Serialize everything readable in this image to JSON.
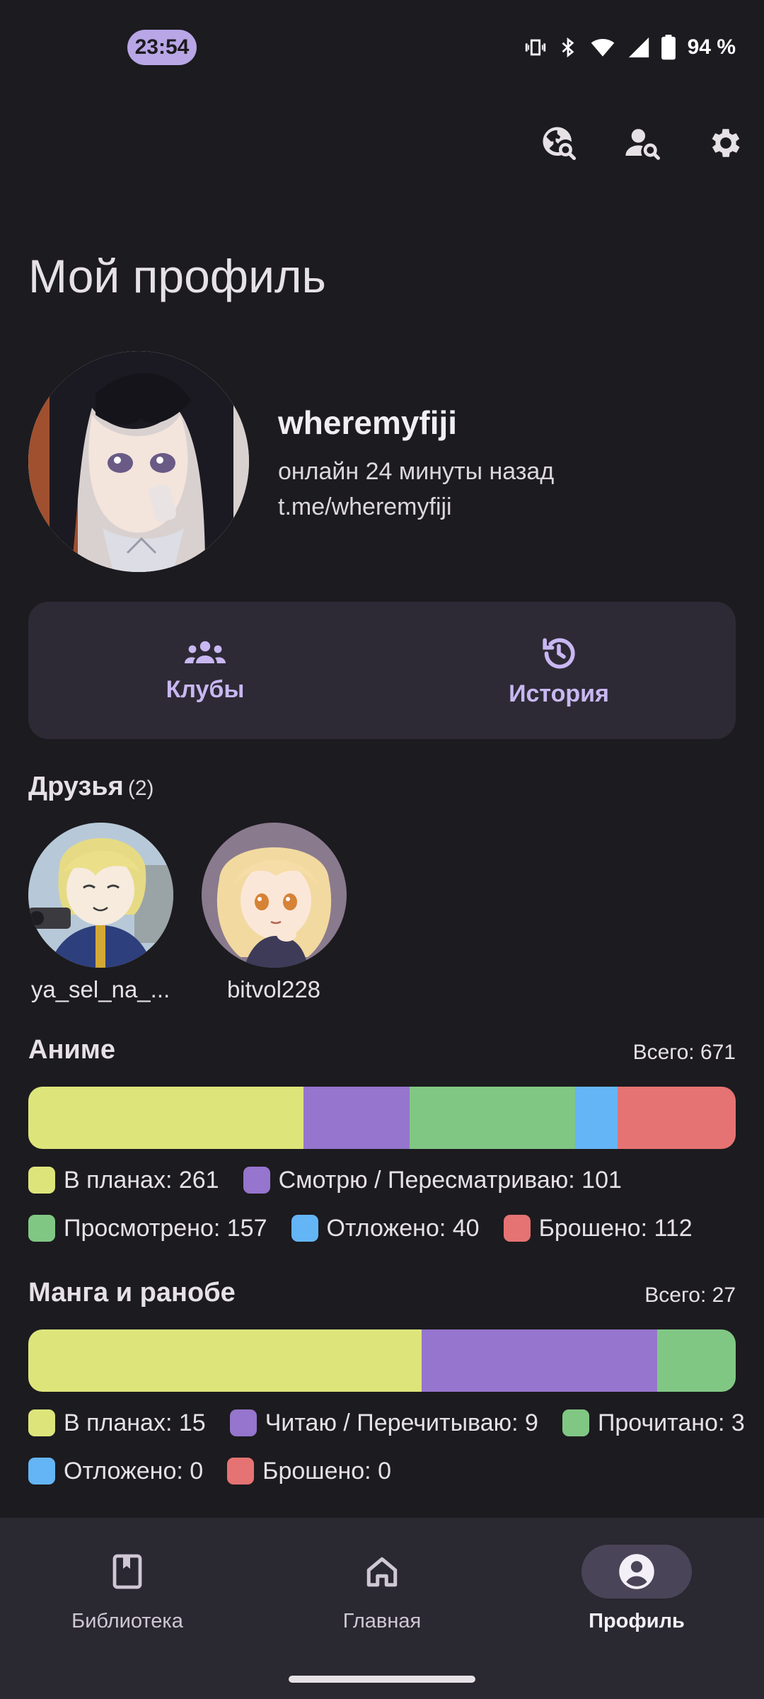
{
  "status_bar": {
    "time": "23:54",
    "battery": "94 %",
    "icons": [
      "vibrate-icon",
      "bluetooth-icon",
      "wifi-icon",
      "signal-icon",
      "battery-icon"
    ]
  },
  "header": {
    "actions": [
      "search-globe-icon",
      "user-search-icon",
      "gear-icon"
    ],
    "title": "Мой профиль"
  },
  "profile": {
    "username": "wheremyfiji",
    "last_seen": "онлайн 24 минуты назад",
    "link": "t.me/wheremyfiji"
  },
  "actions": {
    "clubs_label": "Клубы",
    "history_label": "История"
  },
  "friends": {
    "title": "Друзья",
    "count": "(2)",
    "items": [
      {
        "name": "ya_sel_na_..."
      },
      {
        "name": "bitvol228"
      }
    ]
  },
  "anime": {
    "title": "Аниме",
    "total": "Всего: 671",
    "segments": [
      {
        "label": "В планах: 261",
        "value": 261,
        "color": "#dde57a"
      },
      {
        "label": "Смотрю / Пересматриваю: 101",
        "value": 101,
        "color": "#9575cd"
      },
      {
        "label": "Просмотрено: 157",
        "value": 157,
        "color": "#81c784"
      },
      {
        "label": "Отложено: 40",
        "value": 40,
        "color": "#64b5f6"
      },
      {
        "label": "Брошено: 112",
        "value": 112,
        "color": "#e57373"
      }
    ]
  },
  "manga": {
    "title": "Манга и ранобе",
    "total": "Всего: 27",
    "segments": [
      {
        "label": "В планах: 15",
        "value": 15,
        "color": "#dde57a"
      },
      {
        "label": "Читаю / Перечитываю: 9",
        "value": 9,
        "color": "#9575cd"
      },
      {
        "label": "Прочитано: 3",
        "value": 3,
        "color": "#81c784"
      },
      {
        "label": "Отложено: 0",
        "value": 0,
        "color": "#64b5f6"
      },
      {
        "label": "Брошено: 0",
        "value": 0,
        "color": "#e57373"
      }
    ]
  },
  "bottom_nav": {
    "library": "Библиотека",
    "home": "Главная",
    "profile": "Профиль",
    "active": "profile"
  }
}
